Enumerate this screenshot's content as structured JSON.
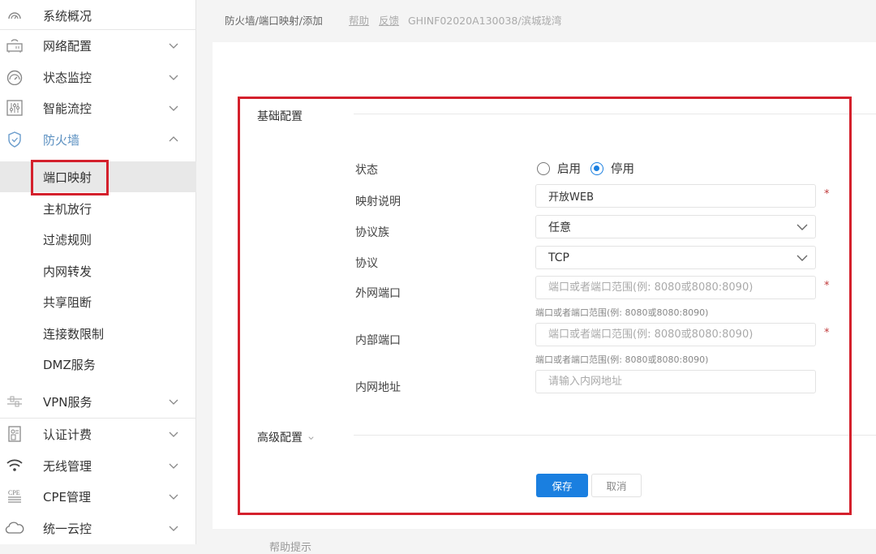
{
  "sidebar": {
    "items": [
      {
        "label": "系统概况",
        "icon": "dashboard-icon"
      },
      {
        "label": "网络配置",
        "icon": "router-icon"
      },
      {
        "label": "状态监控",
        "icon": "gauge-icon"
      },
      {
        "label": "智能流控",
        "icon": "sliders-icon"
      },
      {
        "label": "防火墙",
        "icon": "shield-icon"
      },
      {
        "label": "VPN服务",
        "icon": "vpn-icon"
      },
      {
        "label": "认证计费",
        "icon": "auth-card-icon"
      },
      {
        "label": "无线管理",
        "icon": "wifi-icon"
      },
      {
        "label": "CPE管理",
        "icon": "cpe-icon"
      },
      {
        "label": "统一云控",
        "icon": "cloud-icon"
      }
    ],
    "firewall_sub": [
      {
        "label": "端口映射",
        "selected": true
      },
      {
        "label": "主机放行"
      },
      {
        "label": "过滤规则"
      },
      {
        "label": "内网转发"
      },
      {
        "label": "共享阻断"
      },
      {
        "label": "连接数限制"
      },
      {
        "label": "DMZ服务"
      }
    ]
  },
  "topbar": {
    "breadcrumb": "防火墙/端口映射/添加",
    "help_link": "帮助",
    "feedback_link": "反馈",
    "device": "GHINF02020A130038/滨城珑湾"
  },
  "form": {
    "basic_title": "基础配置",
    "advanced_title": "高级配置",
    "status": {
      "label": "状态",
      "options": [
        "启用",
        "停用"
      ],
      "selected": "停用"
    },
    "description": {
      "label": "映射说明",
      "value": "开放WEB",
      "required": true
    },
    "protocol_family": {
      "label": "协议族",
      "value": "任意"
    },
    "protocol": {
      "label": "协议",
      "value": "TCP"
    },
    "external_port": {
      "label": "外网端口",
      "placeholder": "端口或者端口范围(例: 8080或8080:8090)",
      "hint": "端口或者端口范围(例: 8080或8080:8090)",
      "required": true
    },
    "internal_port": {
      "label": "内部端口",
      "placeholder": "端口或者端口范围(例: 8080或8080:8090)",
      "hint": "端口或者端口范围(例: 8080或8080:8090)",
      "required": true
    },
    "internal_address": {
      "label": "内网地址",
      "placeholder": "请输入内网地址"
    },
    "required_mark": "*",
    "save_label": "保存",
    "cancel_label": "取消"
  },
  "help_panel": {
    "title": "帮助提示"
  },
  "colors": {
    "primary": "#1a7fe0",
    "highlight_box": "#d4202c",
    "active_nav": "#5a8fc0",
    "required": "#c0393b"
  }
}
